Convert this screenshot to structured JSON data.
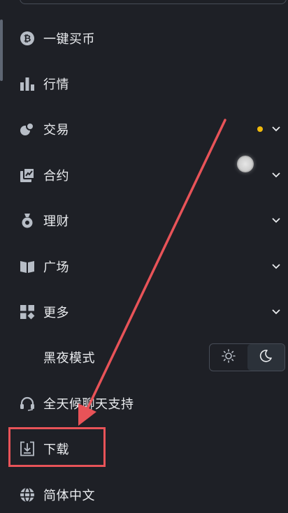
{
  "menu": {
    "items": [
      {
        "id": "buy",
        "label": "一键买币",
        "icon": "bitcoin-icon",
        "chevron": false,
        "dot": false
      },
      {
        "id": "market",
        "label": "行情",
        "icon": "bar-chart-icon",
        "chevron": false,
        "dot": false
      },
      {
        "id": "trade",
        "label": "交易",
        "icon": "trade-icon",
        "chevron": true,
        "dot": true
      },
      {
        "id": "contract",
        "label": "合约",
        "icon": "contract-icon",
        "chevron": true,
        "dot": false
      },
      {
        "id": "earn",
        "label": "理财",
        "icon": "money-bag-icon",
        "chevron": true,
        "dot": false
      },
      {
        "id": "square",
        "label": "广场",
        "icon": "book-icon",
        "chevron": true,
        "dot": false
      },
      {
        "id": "more",
        "label": "更多",
        "icon": "grid-icon",
        "chevron": true,
        "dot": false
      },
      {
        "id": "dark",
        "label": "黑夜模式",
        "icon": "",
        "chevron": false,
        "dot": false
      },
      {
        "id": "support",
        "label": "全天候聊天支持",
        "icon": "headset-icon",
        "chevron": false,
        "dot": false
      },
      {
        "id": "download",
        "label": "下载",
        "icon": "download-icon",
        "chevron": false,
        "dot": false
      },
      {
        "id": "language",
        "label": "简体中文",
        "icon": "globe-icon",
        "chevron": false,
        "dot": false
      }
    ]
  },
  "theme_toggle": {
    "light_icon": "sun-icon",
    "dark_icon": "moon-icon",
    "selected": "dark"
  },
  "colors": {
    "background": "#1e2026",
    "text": "#eaecef",
    "icon": "#b7bdc6",
    "notification_dot": "#f0b90b",
    "annotation": "#e85358"
  }
}
